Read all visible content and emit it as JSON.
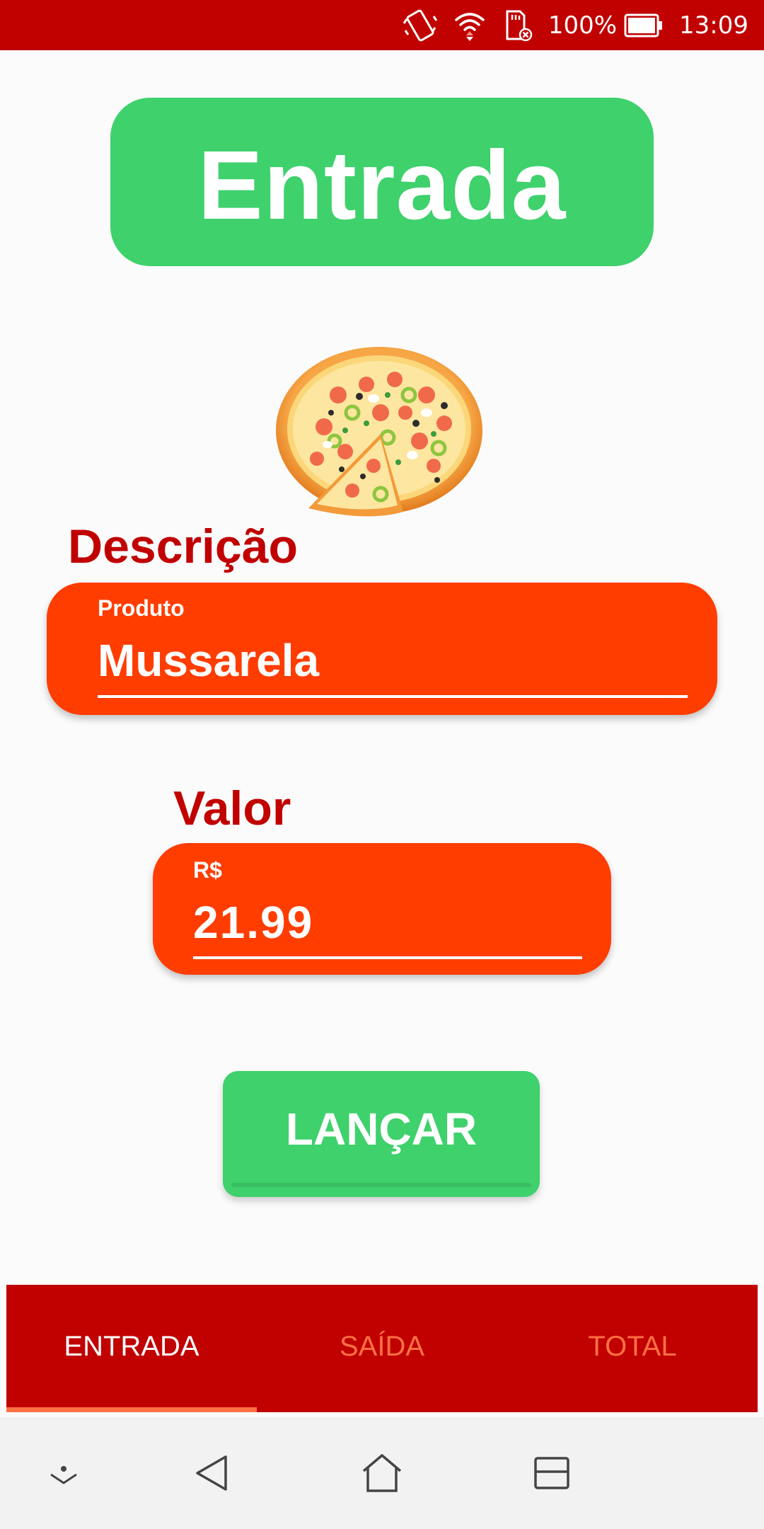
{
  "status_bar": {
    "battery_percent": "100%",
    "time": "13:09",
    "icons": [
      "vibrate-icon",
      "wifi-icon",
      "sd-card-icon",
      "battery-icon"
    ]
  },
  "header": {
    "title": "Entrada"
  },
  "illustration": {
    "icon": "pizza-image"
  },
  "form": {
    "description_label": "Descrição",
    "product_hint": "Produto",
    "product_value": "Mussarela",
    "value_label": "Valor",
    "value_hint": "R$",
    "value_amount": "21.99",
    "submit_label": "LANÇAR"
  },
  "tabs": [
    {
      "label": "ENTRADA",
      "active": true
    },
    {
      "label": "SAÍDA",
      "active": false
    },
    {
      "label": "TOTAL",
      "active": false
    }
  ],
  "nav_bar": {
    "buttons": [
      "collapse-icon",
      "back-icon",
      "home-icon",
      "recents-icon"
    ]
  },
  "colors": {
    "brand_red": "#c10000",
    "accent_orange": "#ff3d00",
    "tab_inactive": "#ff7043",
    "green": "#3fd16c",
    "background": "#fbfbfb"
  }
}
